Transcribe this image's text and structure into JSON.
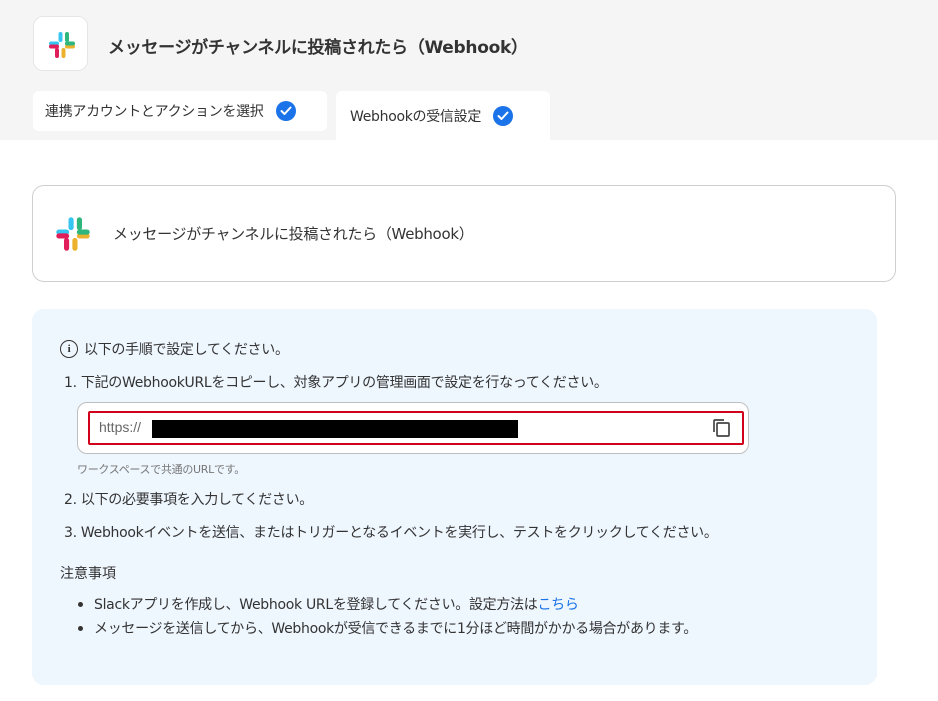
{
  "header": {
    "title": "メッセージがチャンネルに投稿されたら（Webhook）",
    "app_icon": "slack-icon"
  },
  "tabs": [
    {
      "label": "連携アカウントとアクションを選択",
      "completed": true
    },
    {
      "label": "Webhookの受信設定",
      "completed": true,
      "active": true
    }
  ],
  "trigger_card": {
    "icon": "slack-icon",
    "label": "メッセージがチャンネルに投稿されたら（Webhook）"
  },
  "instructions": {
    "intro": "以下の手順で設定してください。",
    "step1": "1. 下記のWebhookURLをコピーし、対象アプリの管理画面で設定を行なってください。",
    "url_prefix": "https://",
    "url_note": "ワークスペースで共通のURLです。",
    "step2": "2. 以下の必要事項を入力してください。",
    "step3": "3. Webhookイベントを送信、またはトリガーとなるイベントを実行し、テストをクリックしてください。"
  },
  "notes": {
    "title": "注意事項",
    "item1_text": "Slackアプリを作成し、Webhook URLを登録してください。設定方法は",
    "item1_link": "こちら",
    "item2": "メッセージを送信してから、Webhookが受信できるまでに1分ほど時間がかかる場合があります。"
  },
  "colors": {
    "accent": "#1a73e8",
    "panel_bg": "#eef6fe",
    "highlight_border": "#d0021b"
  }
}
